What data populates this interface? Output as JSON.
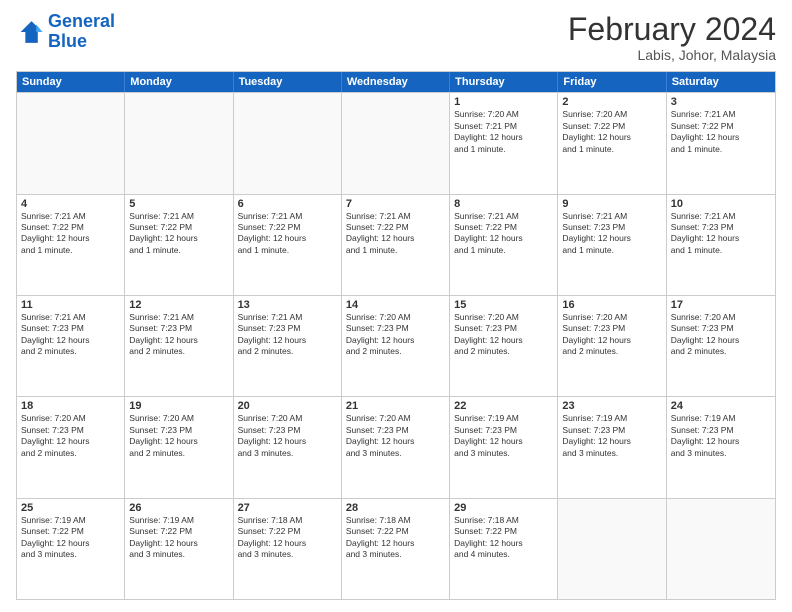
{
  "logo": {
    "line1": "General",
    "line2": "Blue"
  },
  "title": "February 2024",
  "location": "Labis, Johor, Malaysia",
  "header_days": [
    "Sunday",
    "Monday",
    "Tuesday",
    "Wednesday",
    "Thursday",
    "Friday",
    "Saturday"
  ],
  "weeks": [
    [
      {
        "day": "",
        "info": ""
      },
      {
        "day": "",
        "info": ""
      },
      {
        "day": "",
        "info": ""
      },
      {
        "day": "",
        "info": ""
      },
      {
        "day": "1",
        "info": "Sunrise: 7:20 AM\nSunset: 7:21 PM\nDaylight: 12 hours\nand 1 minute."
      },
      {
        "day": "2",
        "info": "Sunrise: 7:20 AM\nSunset: 7:22 PM\nDaylight: 12 hours\nand 1 minute."
      },
      {
        "day": "3",
        "info": "Sunrise: 7:21 AM\nSunset: 7:22 PM\nDaylight: 12 hours\nand 1 minute."
      }
    ],
    [
      {
        "day": "4",
        "info": "Sunrise: 7:21 AM\nSunset: 7:22 PM\nDaylight: 12 hours\nand 1 minute."
      },
      {
        "day": "5",
        "info": "Sunrise: 7:21 AM\nSunset: 7:22 PM\nDaylight: 12 hours\nand 1 minute."
      },
      {
        "day": "6",
        "info": "Sunrise: 7:21 AM\nSunset: 7:22 PM\nDaylight: 12 hours\nand 1 minute."
      },
      {
        "day": "7",
        "info": "Sunrise: 7:21 AM\nSunset: 7:22 PM\nDaylight: 12 hours\nand 1 minute."
      },
      {
        "day": "8",
        "info": "Sunrise: 7:21 AM\nSunset: 7:22 PM\nDaylight: 12 hours\nand 1 minute."
      },
      {
        "day": "9",
        "info": "Sunrise: 7:21 AM\nSunset: 7:23 PM\nDaylight: 12 hours\nand 1 minute."
      },
      {
        "day": "10",
        "info": "Sunrise: 7:21 AM\nSunset: 7:23 PM\nDaylight: 12 hours\nand 1 minute."
      }
    ],
    [
      {
        "day": "11",
        "info": "Sunrise: 7:21 AM\nSunset: 7:23 PM\nDaylight: 12 hours\nand 2 minutes."
      },
      {
        "day": "12",
        "info": "Sunrise: 7:21 AM\nSunset: 7:23 PM\nDaylight: 12 hours\nand 2 minutes."
      },
      {
        "day": "13",
        "info": "Sunrise: 7:21 AM\nSunset: 7:23 PM\nDaylight: 12 hours\nand 2 minutes."
      },
      {
        "day": "14",
        "info": "Sunrise: 7:20 AM\nSunset: 7:23 PM\nDaylight: 12 hours\nand 2 minutes."
      },
      {
        "day": "15",
        "info": "Sunrise: 7:20 AM\nSunset: 7:23 PM\nDaylight: 12 hours\nand 2 minutes."
      },
      {
        "day": "16",
        "info": "Sunrise: 7:20 AM\nSunset: 7:23 PM\nDaylight: 12 hours\nand 2 minutes."
      },
      {
        "day": "17",
        "info": "Sunrise: 7:20 AM\nSunset: 7:23 PM\nDaylight: 12 hours\nand 2 minutes."
      }
    ],
    [
      {
        "day": "18",
        "info": "Sunrise: 7:20 AM\nSunset: 7:23 PM\nDaylight: 12 hours\nand 2 minutes."
      },
      {
        "day": "19",
        "info": "Sunrise: 7:20 AM\nSunset: 7:23 PM\nDaylight: 12 hours\nand 2 minutes."
      },
      {
        "day": "20",
        "info": "Sunrise: 7:20 AM\nSunset: 7:23 PM\nDaylight: 12 hours\nand 3 minutes."
      },
      {
        "day": "21",
        "info": "Sunrise: 7:20 AM\nSunset: 7:23 PM\nDaylight: 12 hours\nand 3 minutes."
      },
      {
        "day": "22",
        "info": "Sunrise: 7:19 AM\nSunset: 7:23 PM\nDaylight: 12 hours\nand 3 minutes."
      },
      {
        "day": "23",
        "info": "Sunrise: 7:19 AM\nSunset: 7:23 PM\nDaylight: 12 hours\nand 3 minutes."
      },
      {
        "day": "24",
        "info": "Sunrise: 7:19 AM\nSunset: 7:23 PM\nDaylight: 12 hours\nand 3 minutes."
      }
    ],
    [
      {
        "day": "25",
        "info": "Sunrise: 7:19 AM\nSunset: 7:22 PM\nDaylight: 12 hours\nand 3 minutes."
      },
      {
        "day": "26",
        "info": "Sunrise: 7:19 AM\nSunset: 7:22 PM\nDaylight: 12 hours\nand 3 minutes."
      },
      {
        "day": "27",
        "info": "Sunrise: 7:18 AM\nSunset: 7:22 PM\nDaylight: 12 hours\nand 3 minutes."
      },
      {
        "day": "28",
        "info": "Sunrise: 7:18 AM\nSunset: 7:22 PM\nDaylight: 12 hours\nand 3 minutes."
      },
      {
        "day": "29",
        "info": "Sunrise: 7:18 AM\nSunset: 7:22 PM\nDaylight: 12 hours\nand 4 minutes."
      },
      {
        "day": "",
        "info": ""
      },
      {
        "day": "",
        "info": ""
      }
    ]
  ]
}
